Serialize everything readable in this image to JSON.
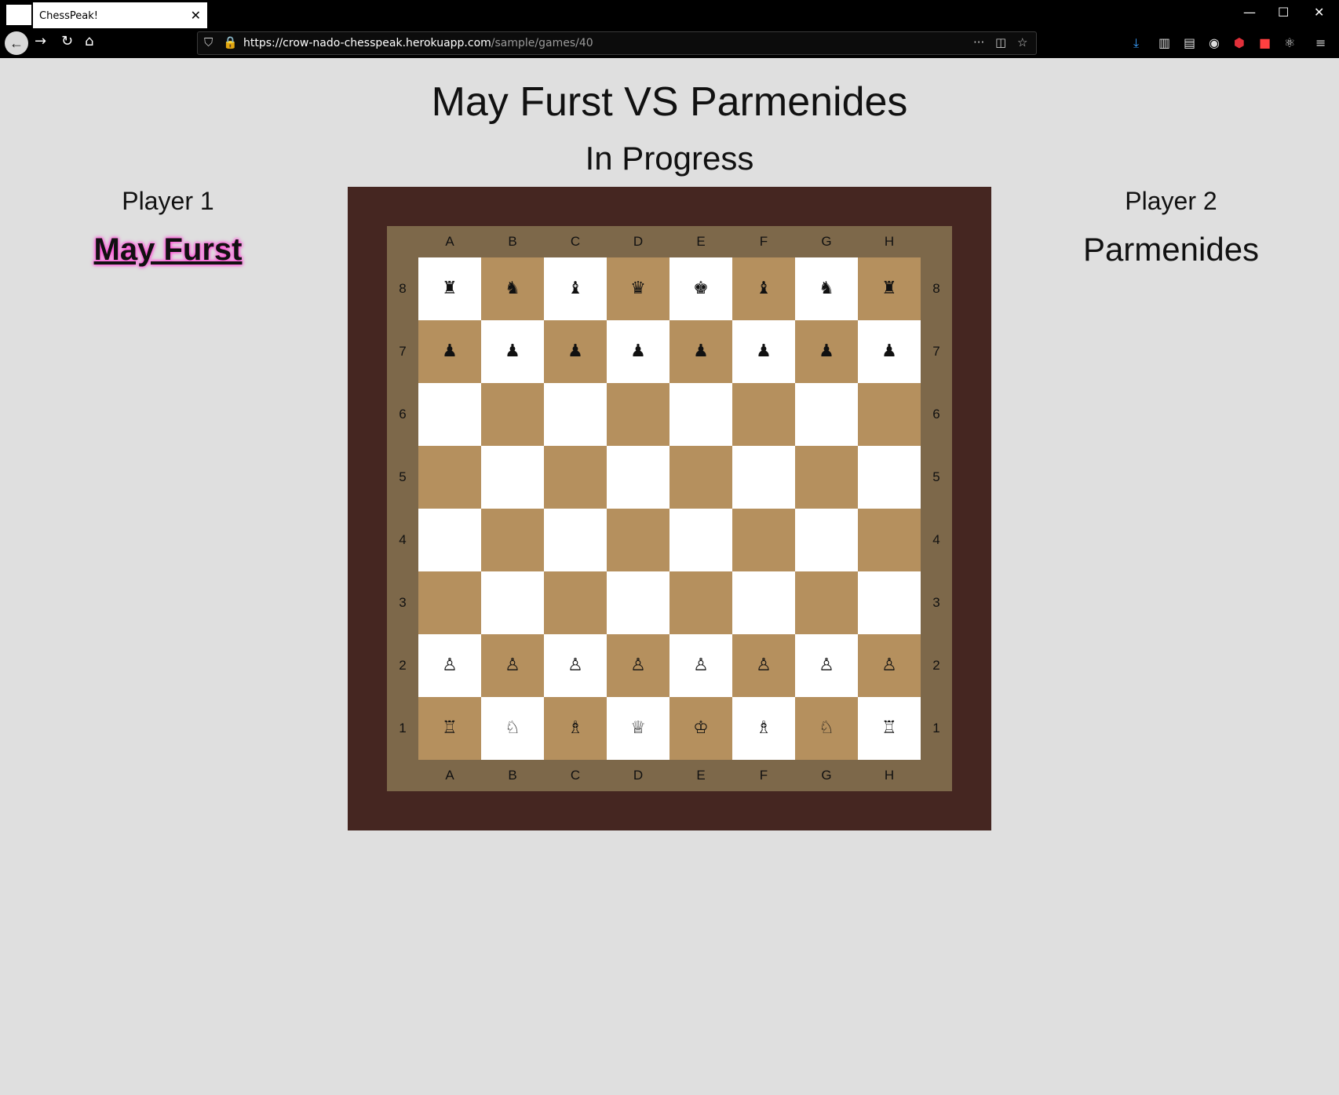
{
  "browser": {
    "tab_title": "ChessPeak!",
    "url_host": "https://crow-nado-chesspeak.herokuapp.com",
    "url_path": "/sample/games/40"
  },
  "game": {
    "title": "May Furst VS Parmenides",
    "status": "In Progress",
    "player1_label": "Player 1",
    "player1_name": "May Furst",
    "player2_label": "Player 2",
    "player2_name": "Parmenides"
  },
  "board": {
    "files": [
      "A",
      "B",
      "C",
      "D",
      "E",
      "F",
      "G",
      "H"
    ],
    "ranks": [
      "8",
      "7",
      "6",
      "5",
      "4",
      "3",
      "2",
      "1"
    ],
    "colors": {
      "light": "#ffffff",
      "dark": "#b5905e",
      "frame": "#452621",
      "inner": "#7d684a"
    },
    "rows": [
      [
        "♜",
        "♞",
        "♝",
        "♛",
        "♚",
        "♝",
        "♞",
        "♜"
      ],
      [
        "♟",
        "♟",
        "♟",
        "♟",
        "♟",
        "♟",
        "♟",
        "♟"
      ],
      [
        "",
        "",
        "",
        "",
        "",
        "",
        "",
        ""
      ],
      [
        "",
        "",
        "",
        "",
        "",
        "",
        "",
        ""
      ],
      [
        "",
        "",
        "",
        "",
        "",
        "",
        "",
        ""
      ],
      [
        "",
        "",
        "",
        "",
        "",
        "",
        "",
        ""
      ],
      [
        "♙",
        "♙",
        "♙",
        "♙",
        "♙",
        "♙",
        "♙",
        "♙"
      ],
      [
        "♖",
        "♘",
        "♗",
        "♕",
        "♔",
        "♗",
        "♘",
        "♖"
      ]
    ]
  }
}
